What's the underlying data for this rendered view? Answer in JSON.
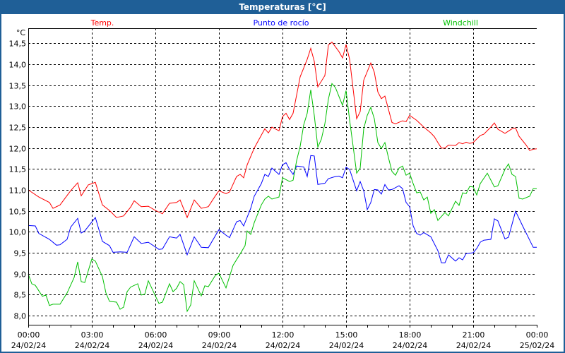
{
  "window": {
    "title": "Temperaturas [°C]"
  },
  "chart_data": {
    "type": "line",
    "title": "Temperaturas [°C]",
    "ylabel": "°C",
    "xlabel": "",
    "x_unit": "minutes since 24/02/24 00:00",
    "xlim": [
      0,
      1440
    ],
    "ylim": [
      7.78,
      14.86
    ],
    "grid": true,
    "yticks": [
      8.0,
      8.5,
      9.0,
      9.5,
      10.0,
      10.5,
      11.0,
      11.5,
      12.0,
      12.5,
      13.0,
      13.5,
      14.0,
      14.5
    ],
    "ytick_labels": [
      "8,0",
      "8,5",
      "9,0",
      "9,5",
      "10,0",
      "10,5",
      "11,0",
      "11,5",
      "12,0",
      "12,5",
      "13,0",
      "13,5",
      "14,0",
      "14,5"
    ],
    "xticks": [
      {
        "x": 0,
        "time": "00:00",
        "date": "24/02/24"
      },
      {
        "x": 180,
        "time": "03:00",
        "date": "24/02/24"
      },
      {
        "x": 360,
        "time": "06:00",
        "date": "24/02/24"
      },
      {
        "x": 540,
        "time": "09:00",
        "date": "24/02/24"
      },
      {
        "x": 720,
        "time": "12:00",
        "date": "24/02/24"
      },
      {
        "x": 900,
        "time": "15:00",
        "date": "24/02/24"
      },
      {
        "x": 1080,
        "time": "18:00",
        "date": "24/02/24"
      },
      {
        "x": 1260,
        "time": "21:00",
        "date": "24/02/24"
      },
      {
        "x": 1440,
        "time": "00:00",
        "date": "25/02/24"
      }
    ],
    "legend_placement": "top",
    "series": [
      {
        "name": "Temp.",
        "color": "#ff0000",
        "x": [
          0,
          30,
          60,
          70,
          90,
          120,
          140,
          150,
          170,
          190,
          210,
          230,
          250,
          270,
          290,
          300,
          320,
          340,
          360,
          380,
          400,
          420,
          430,
          450,
          470,
          490,
          510,
          530,
          540,
          560,
          570,
          590,
          600,
          610,
          620,
          640,
          670,
          680,
          690,
          710,
          720,
          730,
          740,
          750,
          770,
          790,
          800,
          810,
          820,
          840,
          850,
          860,
          880,
          890,
          900,
          910,
          930,
          940,
          950,
          970,
          980,
          990,
          1000,
          1010,
          1030,
          1040,
          1060,
          1070,
          1080,
          1100,
          1120,
          1140,
          1150,
          1160,
          1170,
          1180,
          1190,
          1210,
          1220,
          1230,
          1240,
          1250,
          1260,
          1280,
          1290,
          1310,
          1320,
          1330,
          1350,
          1370,
          1380,
          1390,
          1410,
          1420,
          1430,
          1440
        ],
        "values": [
          11.0,
          10.83,
          10.7,
          10.56,
          10.64,
          10.98,
          11.17,
          10.86,
          11.12,
          11.18,
          10.64,
          10.51,
          10.34,
          10.38,
          10.59,
          10.74,
          10.6,
          10.61,
          10.51,
          10.43,
          10.68,
          10.7,
          10.76,
          10.34,
          10.76,
          10.56,
          10.6,
          10.86,
          10.98,
          10.91,
          10.95,
          11.32,
          11.37,
          11.29,
          11.6,
          12.0,
          12.46,
          12.36,
          12.5,
          12.41,
          12.75,
          12.83,
          12.68,
          12.83,
          13.7,
          14.12,
          14.38,
          14.07,
          13.46,
          13.73,
          14.46,
          14.53,
          14.3,
          14.15,
          14.47,
          14.12,
          12.7,
          12.87,
          13.62,
          14.03,
          13.81,
          13.34,
          13.18,
          13.24,
          12.61,
          12.58,
          12.65,
          12.63,
          12.78,
          12.66,
          12.5,
          12.36,
          12.27,
          12.13,
          12.0,
          12.0,
          12.07,
          12.06,
          12.13,
          12.1,
          12.14,
          12.11,
          12.13,
          12.3,
          12.33,
          12.5,
          12.6,
          12.45,
          12.35,
          12.46,
          12.48,
          12.28,
          12.07,
          11.94,
          11.97,
          11.98
        ]
      },
      {
        "name": "Punto de rocío",
        "color": "#0000ff",
        "x": [
          0,
          20,
          30,
          60,
          80,
          90,
          110,
          120,
          140,
          150,
          160,
          190,
          210,
          230,
          240,
          260,
          280,
          300,
          320,
          340,
          370,
          380,
          400,
          420,
          430,
          450,
          470,
          490,
          510,
          540,
          560,
          570,
          590,
          600,
          610,
          630,
          640,
          660,
          670,
          680,
          690,
          710,
          720,
          730,
          740,
          750,
          760,
          780,
          790,
          800,
          810,
          820,
          840,
          850,
          870,
          880,
          890,
          900,
          910,
          930,
          940,
          950,
          960,
          970,
          980,
          990,
          1000,
          1010,
          1020,
          1030,
          1050,
          1060,
          1070,
          1080,
          1090,
          1100,
          1110,
          1120,
          1140,
          1160,
          1170,
          1180,
          1190,
          1210,
          1220,
          1230,
          1240,
          1260,
          1270,
          1280,
          1290,
          1310,
          1320,
          1330,
          1350,
          1360,
          1380,
          1400,
          1420,
          1430,
          1440
        ],
        "values": [
          10.15,
          10.14,
          9.96,
          9.82,
          9.68,
          9.69,
          9.82,
          10.11,
          10.32,
          9.97,
          10.02,
          10.34,
          9.77,
          9.67,
          9.51,
          9.52,
          9.51,
          9.88,
          9.72,
          9.75,
          9.58,
          9.59,
          9.88,
          9.85,
          9.94,
          9.45,
          9.88,
          9.63,
          9.62,
          10.05,
          9.92,
          9.86,
          10.24,
          10.27,
          10.14,
          10.56,
          10.85,
          11.15,
          11.37,
          11.32,
          11.52,
          11.37,
          11.6,
          11.65,
          11.49,
          11.37,
          11.57,
          11.55,
          11.32,
          11.82,
          11.81,
          11.13,
          11.16,
          11.27,
          11.32,
          11.33,
          11.29,
          11.54,
          11.49,
          10.98,
          11.2,
          10.98,
          10.53,
          10.7,
          11.01,
          11.0,
          10.9,
          11.13,
          11.0,
          11.01,
          11.1,
          11.03,
          10.7,
          10.6,
          10.14,
          9.96,
          9.92,
          9.98,
          9.88,
          9.55,
          9.26,
          9.26,
          9.45,
          9.3,
          9.38,
          9.33,
          9.48,
          9.5,
          9.6,
          9.75,
          9.8,
          9.82,
          10.31,
          10.26,
          9.83,
          9.87,
          10.49,
          10.14,
          9.8,
          9.63,
          9.63
        ]
      },
      {
        "name": "Windchill",
        "color": "#00c000",
        "x": [
          0,
          10,
          20,
          40,
          50,
          60,
          70,
          90,
          110,
          130,
          140,
          150,
          160,
          180,
          190,
          210,
          220,
          230,
          250,
          260,
          270,
          280,
          290,
          310,
          320,
          330,
          340,
          370,
          380,
          400,
          410,
          420,
          430,
          440,
          450,
          460,
          470,
          490,
          500,
          510,
          530,
          540,
          560,
          580,
          600,
          614,
          620,
          630,
          640,
          660,
          670,
          680,
          690,
          710,
          720,
          740,
          750,
          760,
          770,
          780,
          790,
          800,
          810,
          820,
          830,
          840,
          850,
          860,
          870,
          890,
          900,
          910,
          920,
          930,
          940,
          950,
          960,
          970,
          980,
          990,
          1000,
          1010,
          1020,
          1030,
          1040,
          1050,
          1060,
          1070,
          1080,
          1090,
          1100,
          1110,
          1120,
          1130,
          1140,
          1150,
          1160,
          1180,
          1190,
          1210,
          1220,
          1230,
          1240,
          1250,
          1260,
          1270,
          1280,
          1300,
          1320,
          1330,
          1350,
          1360,
          1370,
          1380,
          1390,
          1400,
          1420,
          1430,
          1440
        ],
        "values": [
          8.99,
          8.76,
          8.72,
          8.46,
          8.49,
          8.24,
          8.27,
          8.27,
          8.54,
          8.91,
          9.28,
          8.81,
          8.79,
          9.35,
          9.3,
          8.93,
          8.54,
          8.34,
          8.32,
          8.15,
          8.2,
          8.57,
          8.68,
          8.76,
          8.49,
          8.51,
          8.83,
          8.29,
          8.32,
          8.76,
          8.57,
          8.65,
          8.81,
          8.74,
          8.1,
          8.25,
          8.83,
          8.47,
          8.71,
          8.69,
          8.96,
          9.01,
          8.66,
          9.2,
          9.47,
          9.67,
          10.02,
          9.94,
          10.22,
          10.64,
          10.78,
          10.85,
          10.78,
          10.83,
          11.29,
          11.2,
          11.23,
          11.7,
          12.04,
          12.55,
          12.83,
          13.39,
          12.78,
          12.02,
          12.21,
          12.58,
          13.17,
          13.54,
          13.44,
          13.02,
          13.37,
          12.67,
          12.04,
          11.4,
          11.52,
          12.46,
          12.78,
          12.97,
          12.7,
          12.13,
          11.99,
          12.13,
          11.77,
          11.44,
          11.35,
          11.52,
          11.57,
          11.35,
          11.4,
          11.15,
          10.93,
          10.95,
          10.76,
          10.83,
          10.44,
          10.53,
          10.27,
          10.46,
          10.38,
          10.73,
          10.63,
          10.93,
          10.91,
          11.08,
          11.07,
          10.88,
          11.15,
          11.4,
          11.07,
          11.1,
          11.49,
          11.62,
          11.37,
          11.32,
          10.8,
          10.78,
          10.85,
          11.03,
          11.03
        ]
      }
    ]
  }
}
